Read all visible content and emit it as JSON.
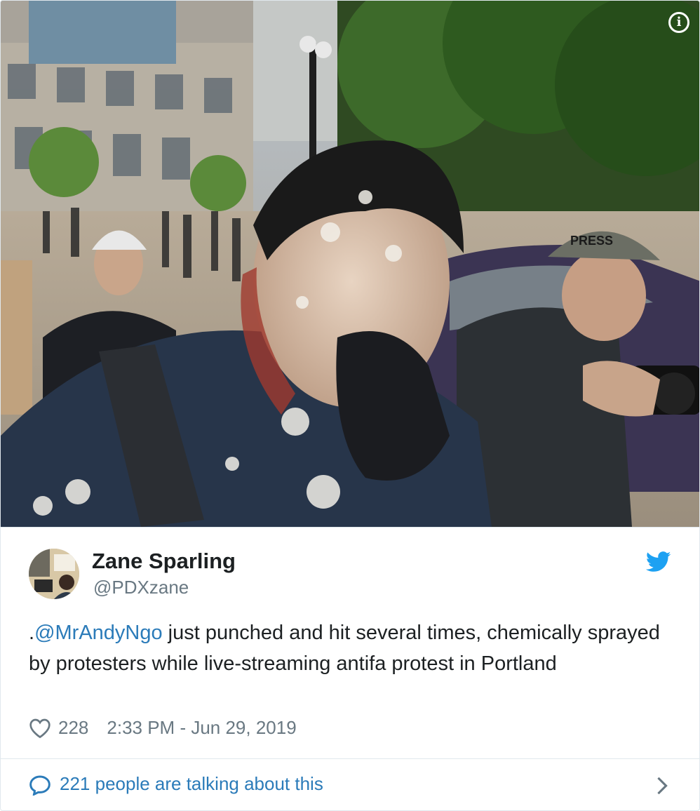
{
  "media": {
    "alt": "Photo of an injured man covered in white liquid holding hand to his face at a protest, with a press photographer beside him",
    "press_helmet_text": "PRESS"
  },
  "author": {
    "name": "Zane Sparling",
    "handle": "@PDXzane"
  },
  "tweet": {
    "prefix": ".",
    "mention": "@MrAndyNgo",
    "body": " just punched and hit several times, chemically sprayed by protesters while live-streaming antifa protest in Portland",
    "likes": "228",
    "timestamp": "2:33 PM - Jun 29, 2019"
  },
  "footer": {
    "talking": "221 people are talking about this"
  },
  "colors": {
    "link": "#2b7bb9",
    "meta": "#697882",
    "twitter_blue": "#1da1f2"
  },
  "icons": [
    "info-icon",
    "twitter-bird-icon",
    "heart-icon",
    "speech-bubble-icon",
    "chevron-right-icon"
  ]
}
